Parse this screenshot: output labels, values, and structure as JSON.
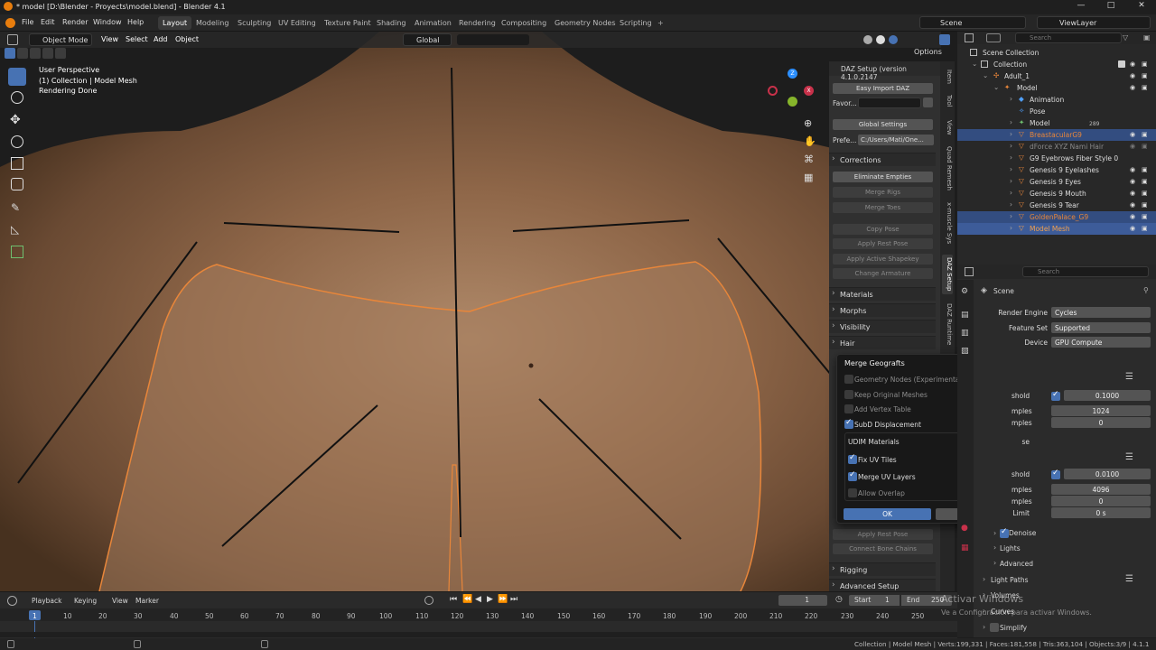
{
  "window": {
    "title": "* model [D:\\Blender - Proyects\\model.blend] - Blender 4.1",
    "controls": [
      "—",
      "□",
      "✕"
    ]
  },
  "menu": [
    "File",
    "Edit",
    "Render",
    "Window",
    "Help"
  ],
  "workspaces": [
    "Layout",
    "Modeling",
    "Sculpting",
    "UV Editing",
    "Texture Paint",
    "Shading",
    "Animation",
    "Rendering",
    "Compositing",
    "Geometry Nodes",
    "Scripting"
  ],
  "workspace_add": "+",
  "scene": {
    "label": "Scene",
    "viewlayer": "ViewLayer"
  },
  "viewport_header": {
    "mode": "Object Mode",
    "menus": [
      "View",
      "Select",
      "Add",
      "Object"
    ],
    "transform": "Global",
    "options": "Options"
  },
  "viewport_info": {
    "line1": "User Perspective",
    "line2": "(1) Collection | Model Mesh",
    "line3": "Rendering Done"
  },
  "npanel": {
    "header": "DAZ Setup (version 4.1.0.2147",
    "easy_import": "Easy Import DAZ",
    "favor_label": "Favor...",
    "global_settings": "Global Settings",
    "prefe_label": "Prefe...",
    "prefe_value": "C:/Users/Mati/One...",
    "corrections": "Corrections",
    "buttons": [
      "Eliminate Empties",
      "Merge Rigs",
      "Merge Toes",
      "Copy Pose",
      "Apply Rest Pose",
      "Apply Active Shapekey",
      "Change Armature"
    ],
    "sections": [
      "Materials",
      "Morphs",
      "Visibility",
      "Hair"
    ],
    "lower_buttons": [
      "Apply Rest Pose",
      "Connect Bone Chains"
    ],
    "lower_sections": [
      "Rigging",
      "Advanced Setup"
    ]
  },
  "sidetabs": [
    "Item",
    "Tool",
    "View",
    "Quad Remesh",
    "x-muscle Sys",
    "DAZ Setup",
    "DAZ Runtime"
  ],
  "dialog": {
    "title": "Merge Geografts",
    "options": [
      {
        "label": "Geometry Nodes (Experimental)",
        "checked": false,
        "enabled": false
      },
      {
        "label": "Keep Original Meshes",
        "checked": false,
        "enabled": false
      },
      {
        "label": "Add Vertex Table",
        "checked": false,
        "enabled": false
      },
      {
        "label": "SubD Displacement",
        "checked": true,
        "enabled": true
      }
    ],
    "udim_title": "UDIM Materials",
    "udim_options": [
      {
        "label": "Fix UV Tiles",
        "checked": true,
        "enabled": true
      },
      {
        "label": "Merge UV Layers",
        "checked": true,
        "enabled": true
      },
      {
        "label": "Allow Overlap",
        "checked": false,
        "enabled": false
      }
    ],
    "ok": "OK",
    "cancel": "Cancel"
  },
  "outliner": {
    "search_placeholder": "Search",
    "rows": [
      {
        "label": "Scene Collection",
        "indent": 0,
        "selected": false,
        "color": "#dddddd"
      },
      {
        "label": "Collection",
        "indent": 1,
        "selected": false,
        "color": "#dddddd"
      },
      {
        "label": "Adult_1",
        "indent": 2,
        "selected": false,
        "color": "#dddddd"
      },
      {
        "label": "Model",
        "indent": 3,
        "selected": false,
        "color": "#dddddd"
      },
      {
        "label": "Animation",
        "indent": 4,
        "selected": false,
        "color": "#dddddd"
      },
      {
        "label": "Pose",
        "indent": 4,
        "selected": false,
        "color": "#dddddd"
      },
      {
        "label": "Model",
        "indent": 4,
        "selected": false,
        "color": "#dddddd"
      },
      {
        "label": "BreastacularG9",
        "indent": 4,
        "selected": true,
        "color": "#e8863a"
      },
      {
        "label": "dForce XYZ Nami Hair",
        "indent": 4,
        "selected": false,
        "color": "#8a8a8a"
      },
      {
        "label": "G9 Eyebrows Fiber Style 0",
        "indent": 4,
        "selected": false,
        "color": "#dddddd"
      },
      {
        "label": "Genesis 9 Eyelashes",
        "indent": 4,
        "selected": false,
        "color": "#dddddd"
      },
      {
        "label": "Genesis 9 Eyes",
        "indent": 4,
        "selected": false,
        "color": "#dddddd"
      },
      {
        "label": "Genesis 9 Mouth",
        "indent": 4,
        "selected": false,
        "color": "#dddddd"
      },
      {
        "label": "Genesis 9 Tear",
        "indent": 4,
        "selected": false,
        "color": "#dddddd"
      },
      {
        "label": "GoldenPalace_G9",
        "indent": 4,
        "selected": true,
        "color": "#e8863a"
      },
      {
        "label": "Model Mesh",
        "indent": 4,
        "selected": true,
        "color": "#f0a050"
      }
    ],
    "model_badge": "289"
  },
  "properties": {
    "search_placeholder": "Search",
    "scene": "Scene",
    "render_engine_label": "Render Engine",
    "render_engine": "Cycles",
    "feature_set_label": "Feature Set",
    "feature_set": "Supported",
    "device_label": "Device",
    "device": "GPU Compute",
    "partial_rows": [
      {
        "label": "shold",
        "value": "0.1000",
        "checked": true
      },
      {
        "label": "mples",
        "value": "1024"
      },
      {
        "label": "mples",
        "value": "0"
      },
      {
        "label": "se",
        "value": ""
      },
      {
        "label": "shold",
        "value": "0.0100",
        "checked": true
      },
      {
        "label": "mples",
        "value": "4096"
      },
      {
        "label": "mples",
        "value": "0"
      },
      {
        "label": "Limit",
        "value": "0 s"
      }
    ],
    "subsections": [
      "Denoise",
      "Lights",
      "Advanced"
    ],
    "sections": [
      "Light Paths",
      "Volumes",
      "Curves",
      "Simplify"
    ]
  },
  "timeline": {
    "menus": [
      "Playback",
      "Keying",
      "View",
      "Marker"
    ],
    "current_frame": "1",
    "start_label": "Start",
    "start": "1",
    "end_label": "End",
    "end": "250",
    "ticks": [
      "1",
      "10",
      "20",
      "30",
      "40",
      "50",
      "60",
      "70",
      "80",
      "90",
      "100",
      "110",
      "120",
      "130",
      "140",
      "150",
      "160",
      "170",
      "180",
      "190",
      "200",
      "210",
      "220",
      "230",
      "240",
      "250"
    ]
  },
  "watermark": {
    "line1": "Activar Windows",
    "line2": "Ve a Configuración para activar Windows."
  },
  "status": "Collection | Model Mesh | Verts:199,331 | Faces:181,558 | Tris:363,104 | Objects:3/9 | 4.1.1",
  "colors": {
    "accent": "#4772b3",
    "selected_row": "#334d80",
    "outline_orange": "#e8863a"
  }
}
